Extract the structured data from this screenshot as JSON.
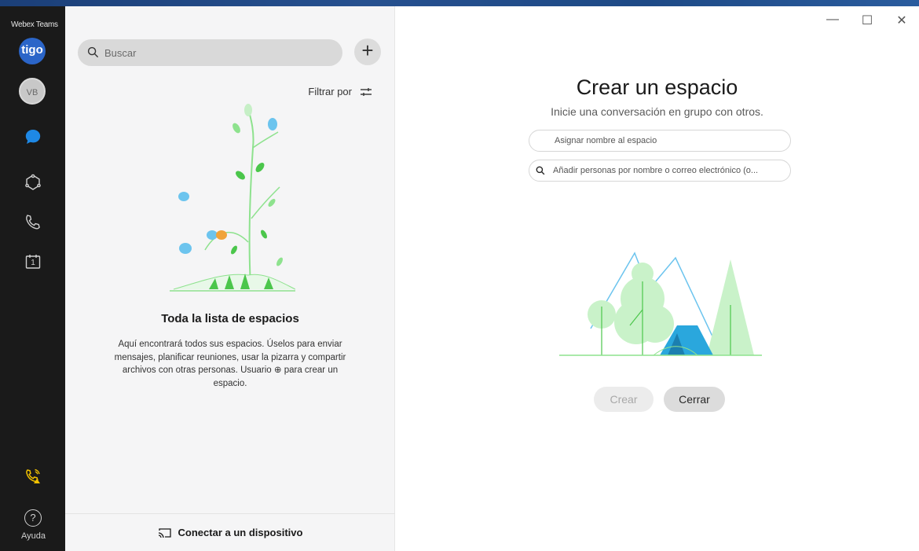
{
  "app": {
    "title": "Webex Teams",
    "org_logo_text": "tigo",
    "avatar_initials": "VB"
  },
  "nav": {
    "items": [
      {
        "id": "messaging",
        "icon": "chat-bubble-icon",
        "active": true
      },
      {
        "id": "teams",
        "icon": "teams-icon",
        "active": false
      },
      {
        "id": "calls",
        "icon": "phone-icon",
        "active": false
      },
      {
        "id": "meetings",
        "icon": "calendar-icon",
        "active": false,
        "badge": "1"
      }
    ],
    "call_status_icon": "phone-warning-icon",
    "help_label": "Ayuda",
    "help_glyph": "?"
  },
  "spaces": {
    "search_placeholder": "Buscar",
    "add_label": "+",
    "filter_label": "Filtrar por",
    "empty_title": "Toda la lista de espacios",
    "empty_description": "Aquí encontrará todos sus espacios. Úselos para enviar mensajes, planificar reuniones, usar la pizarra y compartir archivos con otras personas. Usuario ⊕ para crear un espacio.",
    "connect_label": "Conectar a un dispositivo"
  },
  "window": {
    "minimize": "—",
    "maximize": "☐",
    "close": "✕"
  },
  "create_space": {
    "title": "Crear un espacio",
    "subtitle": "Inicie una conversación en grupo con otros.",
    "name_placeholder": "Asignar nombre al espacio",
    "people_placeholder": "Añadir personas por nombre o correo electrónico (o...",
    "create_label": "Crear",
    "close_label": "Cerrar"
  },
  "colors": {
    "rail_bg": "#1a1a1a",
    "accent_blue": "#1e88e5",
    "illustration_green": "#8ee28e",
    "tent_blue": "#2aa7dd"
  }
}
